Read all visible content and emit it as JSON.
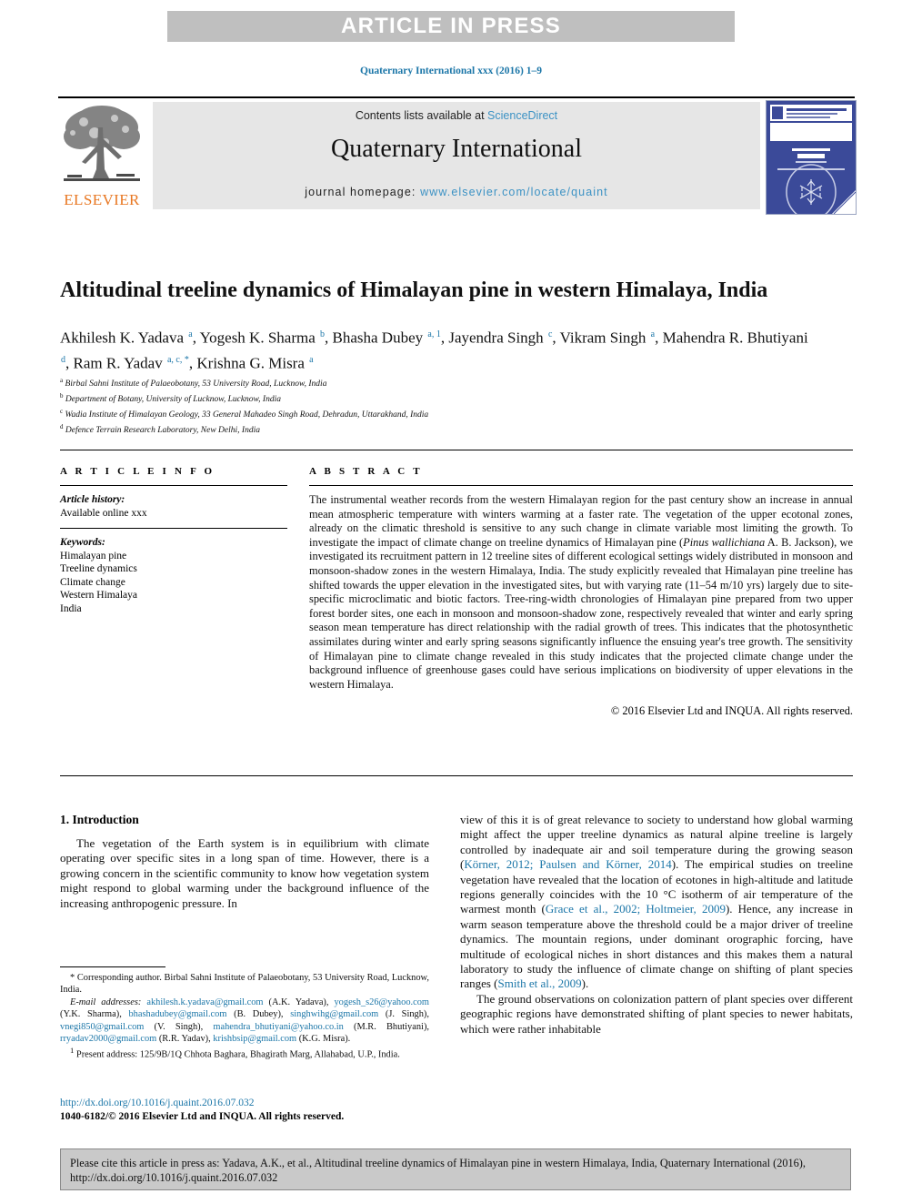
{
  "banner": {
    "text": "ARTICLE IN PRESS"
  },
  "journal_ref": "Quaternary International xxx (2016) 1–9",
  "masthead": {
    "contents_prefix": "Contents lists available at ",
    "contents_link": "ScienceDirect",
    "journal_title": "Quaternary International",
    "homepage_prefix": "journal homepage: ",
    "homepage_link": "www.elsevier.com/locate/quaint",
    "publisher_name": "ELSEVIER",
    "cover_title": "QUATERNARY INTERNATIONAL"
  },
  "article": {
    "title": "Altitudinal treeline dynamics of Himalayan pine in western Himalaya, India",
    "authors_line1": "Akhilesh K. Yadava",
    "authors_html": "Akhilesh K. Yadava <sup>a</sup>, Yogesh K. Sharma <sup>b</sup>, Bhasha Dubey <sup>a, 1</sup>, Jayendra Singh <sup>c</sup>, Vikram Singh <sup>a</sup>, Mahendra R. Bhutiyani <sup>d</sup>, Ram R. Yadav <sup>a, c, *</sup>, Krishna G. Misra <sup>a</sup>",
    "affiliations": [
      {
        "marker": "a",
        "text": "Birbal Sahni Institute of Palaeobotany, 53 University Road, Lucknow, India"
      },
      {
        "marker": "b",
        "text": "Department of Botany, University of Lucknow, Lucknow, India"
      },
      {
        "marker": "c",
        "text": "Wadia Institute of Himalayan Geology, 33 General Mahadeo Singh Road, Dehradun, Uttarakhand, India"
      },
      {
        "marker": "d",
        "text": "Defence Terrain Research Laboratory, New Delhi, India"
      }
    ]
  },
  "article_info": {
    "heading": "A R T I C L E   I N F O",
    "history_label": "Article history:",
    "history_value": "Available online xxx",
    "keywords_label": "Keywords:",
    "keywords": [
      "Himalayan pine",
      "Treeline dynamics",
      "Climate change",
      "Western Himalaya",
      "India"
    ]
  },
  "abstract": {
    "heading": "A B S T R A C T",
    "text_html": "The instrumental weather records from the western Himalayan region for the past century show an increase in annual mean atmospheric temperature with winters warming at a faster rate. The vegetation of the upper ecotonal zones, already on the climatic threshold is sensitive to any such change in climate variable most limiting the growth. To investigate the impact of climate change on treeline dynamics of Himalayan pine (<i>Pinus wallichiana</i> A. B. Jackson), we investigated its recruitment pattern in 12 treeline sites of different ecological settings widely distributed in monsoon and monsoon-shadow zones in the western Himalaya, India. The study explicitly revealed that Himalayan pine treeline has shifted towards the upper elevation in the investigated sites, but with varying rate (11–54 m/10 yrs) largely due to site-specific microclimatic and biotic factors. Tree-ring-width chronologies of Himalayan pine prepared from two upper forest border sites, one each in monsoon and monsoon-shadow zone, respectively revealed that winter and early spring season mean temperature has direct relationship with the radial growth of trees. This indicates that the photosynthetic assimilates during winter and early spring seasons significantly influence the ensuing year's tree growth. The sensitivity of Himalayan pine to climate change revealed in this study indicates that the projected climate change under the background influence of greenhouse gases could have serious implications on biodiversity of upper elevations in the western Himalaya.",
    "copyright": "© 2016 Elsevier Ltd and INQUA. All rights reserved."
  },
  "body": {
    "section_heading": "1. Introduction",
    "left_paragraph": "The vegetation of the Earth system is in equilibrium with climate operating over specific sites in a long span of time. However, there is a growing concern in the scientific community to know how vegetation system might respond to global warming under the background influence of the increasing anthropogenic pressure. In",
    "right_paragraph_1_html": "view of this it is of great relevance to society to understand how global warming might affect the upper treeline dynamics as natural alpine treeline is largely controlled by inadequate air and soil temperature during the growing season (<span class=\"cite\">Körner, 2012; Paulsen and Körner, 2014</span>). The empirical studies on treeline vegetation have revealed that the location of ecotones in high-altitude and latitude regions generally coincides with the 10 °C isotherm of air temperature of the warmest month (<span class=\"cite\">Grace et al., 2002; Holtmeier, 2009</span>). Hence, any increase in warm season temperature above the threshold could be a major driver of treeline dynamics. The mountain regions, under dominant orographic forcing, have multitude of ecological niches in short distances and this makes them a natural laboratory to study the influence of climate change on shifting of plant species ranges (<span class=\"cite\">Smith et al., 2009</span>).",
    "right_paragraph_2": "The ground observations on colonization pattern of plant species over different geographic regions have demonstrated shifting of plant species to newer habitats, which were rather inhabitable"
  },
  "footnotes": {
    "corresponding_html": "* Corresponding author. Birbal Sahni Institute of Palaeobotany, 53 University Road, Lucknow, India.",
    "emails_html": "<span class=\"em\">E-mail addresses:</span> <a>akhilesh.k.yadava@gmail.com</a> (A.K. Yadava), <a>yogesh_s26@yahoo.com</a> (Y.K. Sharma), <a>bhashadubey@gmail.com</a> (B. Dubey), <a>singhwihg@gmail.com</a> (J. Singh), <a>vnegi850@gmail.com</a> (V. Singh), <a>mahendra_bhutiyani@yahoo.co.in</a> (M.R. Bhutiyani), <a>rryadav2000@gmail.com</a> (R.R. Yadav), <a>krishbsip@gmail.com</a> (K.G. Misra).",
    "present_address_html": "<sup>1</sup> Present address: 125/9B/1Q Chhota Baghara, Bhagirath Marg, Allahabad, U.P., India."
  },
  "doi": {
    "link": "http://dx.doi.org/10.1016/j.quaint.2016.07.032",
    "issn_line": "1040-6182/© 2016 Elsevier Ltd and INQUA. All rights reserved."
  },
  "cite_box": {
    "text": "Please cite this article in press as: Yadava, A.K., et al., Altitudinal treeline dynamics of Himalayan pine in western Himalaya, India, Quaternary International (2016), http://dx.doi.org/10.1016/j.quaint.2016.07.032"
  },
  "colors": {
    "link_blue": "#1b76a8",
    "sd_blue": "#3c92c4",
    "elsevier_orange": "#e87722",
    "banner_gray": "#bfbfbf",
    "masthead_gray": "#e6e6e6",
    "cite_box_gray": "#c9c9c9"
  }
}
